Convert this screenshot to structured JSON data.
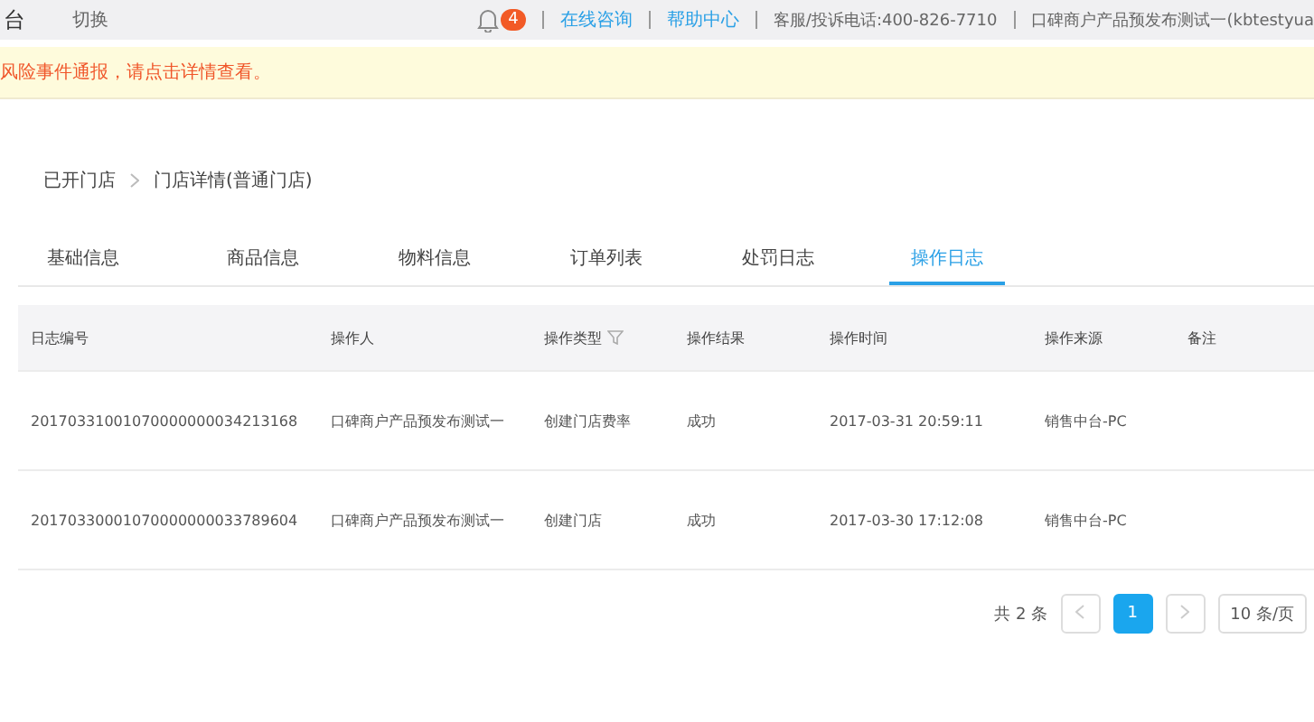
{
  "header": {
    "logo_fragment": "台",
    "switch_label": "切换",
    "notification_count": "4",
    "links": [
      "在线咨询",
      "帮助中心"
    ],
    "hotline": "客服/投诉电话:400-826-7710",
    "account": "口碑商户产品预发布测试一(kbtestyua"
  },
  "alert": {
    "text": "风险事件通报，请点击详情查看。"
  },
  "breadcrumb": [
    "已开门店",
    "门店详情(普通门店)"
  ],
  "tabs": [
    {
      "label": "基础信息",
      "selected": false
    },
    {
      "label": "商品信息",
      "selected": false
    },
    {
      "label": "物料信息",
      "selected": false
    },
    {
      "label": "订单列表",
      "selected": false
    },
    {
      "label": "处罚日志",
      "selected": false
    },
    {
      "label": "操作日志",
      "selected": true
    }
  ],
  "table": {
    "columns": [
      {
        "label": "日志编号",
        "filter": false
      },
      {
        "label": "操作人",
        "filter": false
      },
      {
        "label": "操作类型",
        "filter": true
      },
      {
        "label": "操作结果",
        "filter": false
      },
      {
        "label": "操作时间",
        "filter": false
      },
      {
        "label": "操作来源",
        "filter": false
      },
      {
        "label": "备注",
        "filter": false
      }
    ],
    "rows": [
      [
        "20170331001070000000034213168",
        "口碑商户产品预发布测试一",
        "创建门店费率",
        "成功",
        "2017-03-31 20:59:11",
        "销售中台-PC",
        ""
      ],
      [
        "20170330001070000000033789604",
        "口碑商户产品预发布测试一",
        "创建门店",
        "成功",
        "2017-03-30 17:12:08",
        "销售中台-PC",
        ""
      ]
    ]
  },
  "pagination": {
    "total": "共 2 条",
    "pages": [
      {
        "label": "1",
        "selected": true
      }
    ],
    "page_size": "10 条/页"
  }
}
